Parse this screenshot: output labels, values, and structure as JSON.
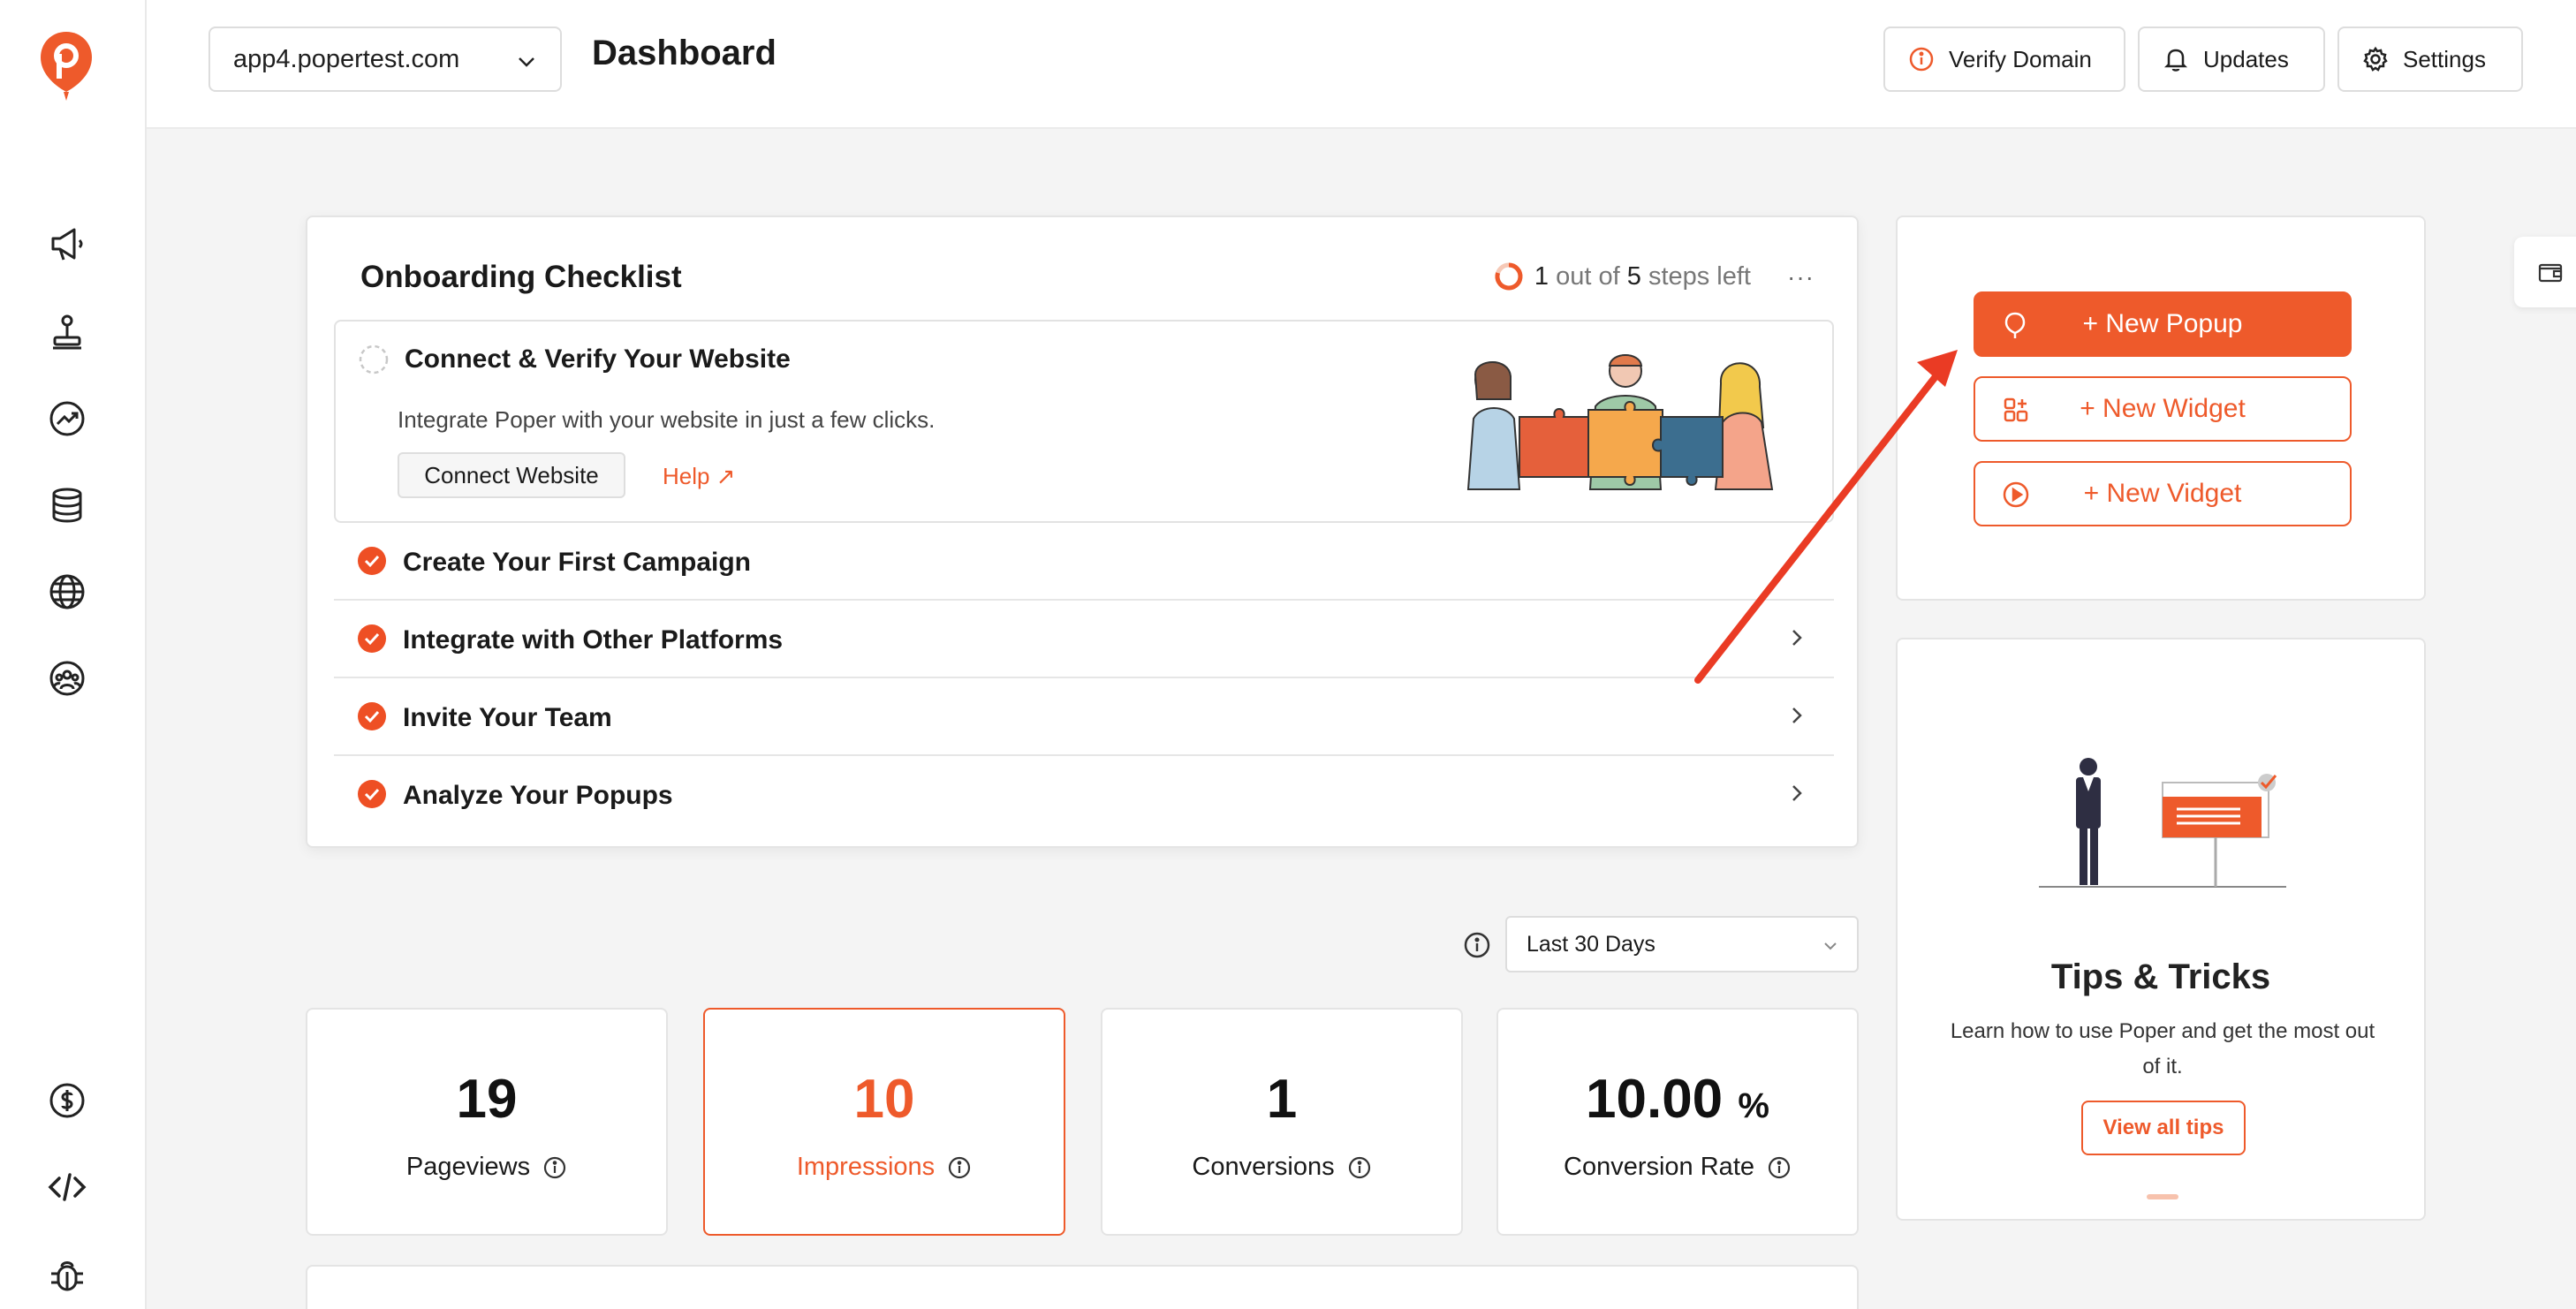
{
  "header": {
    "domain": "app4.popertest.com",
    "title": "Dashboard",
    "buttons": {
      "verify": "Verify Domain",
      "updates": "Updates",
      "settings": "Settings"
    }
  },
  "sidebar": {
    "icons": [
      "megaphone-icon",
      "joystick-icon",
      "analytics-icon",
      "database-icon",
      "globe-icon",
      "team-icon",
      "billing-icon",
      "code-icon",
      "bug-icon"
    ]
  },
  "checklist": {
    "title": "Onboarding Checklist",
    "progress": {
      "done": "1",
      "mid": "out of",
      "total": "5",
      "suffix": "steps left"
    },
    "menu": "···",
    "open_step": {
      "title": "Connect & Verify Your Website",
      "description": "Integrate Poper with your website in just a few clicks.",
      "button": "Connect Website",
      "help": "Help ↗"
    },
    "steps": [
      {
        "label": "Create Your First Campaign"
      },
      {
        "label": "Integrate with Other Platforms"
      },
      {
        "label": "Invite Your Team"
      },
      {
        "label": "Analyze Your Popups"
      }
    ]
  },
  "filter": {
    "range": "Last 30 Days"
  },
  "stats": [
    {
      "value": "19",
      "label": "Pageviews"
    },
    {
      "value": "10",
      "label": "Impressions"
    },
    {
      "value": "1",
      "label": "Conversions"
    },
    {
      "value": "10.00",
      "unit": "%",
      "label": "Conversion Rate"
    }
  ],
  "actions": {
    "popup": "+ New Popup",
    "widget": "+ New Widget",
    "vidget": "+ New Vidget"
  },
  "tips": {
    "title": "Tips & Tricks",
    "description": "Learn how to use Poper and get the most out of it.",
    "button": "View all tips"
  },
  "colors": {
    "accent": "#ee5a2b",
    "border": "#e4e4e4",
    "background": "#f4f4f4"
  }
}
